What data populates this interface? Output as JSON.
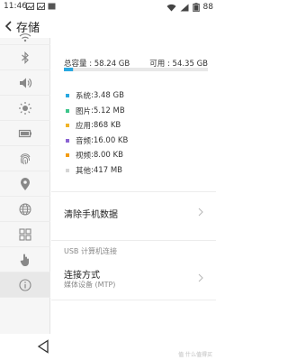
{
  "status": {
    "time": "11:46",
    "battery": "88"
  },
  "header": {
    "title": "存储"
  },
  "sidebar": {
    "items": [
      {
        "icon": "wifi-icon"
      },
      {
        "icon": "bluetooth-icon"
      },
      {
        "icon": "sound-icon"
      },
      {
        "icon": "brightness-icon"
      },
      {
        "icon": "battery-icon"
      },
      {
        "icon": "fingerprint-icon"
      },
      {
        "icon": "location-icon"
      },
      {
        "icon": "globe-icon"
      },
      {
        "icon": "apps-grid-icon"
      },
      {
        "icon": "hand-icon"
      },
      {
        "icon": "info-icon",
        "active": true
      }
    ]
  },
  "storage": {
    "total_label": "总容量 : 58.24 GB",
    "available_label": "可用 : 54.35 GB",
    "used_fraction": 0.067,
    "segments": [
      {
        "name": "系统",
        "value": "3.48 GB",
        "color": "#29a8e0",
        "fraction": 0.06
      },
      {
        "name": "图片",
        "value": "5.12 MB",
        "color": "#3cc58a",
        "fraction": 0.0015
      },
      {
        "name": "应用",
        "value": "868 KB",
        "color": "#f0b429",
        "fraction": 0.0015
      },
      {
        "name": "音频",
        "value": "16.00 KB",
        "color": "#8a63d2",
        "fraction": 0.001
      },
      {
        "name": "视频",
        "value": "8.00 KB",
        "color": "#f39c12",
        "fraction": 0.001
      },
      {
        "name": "其他",
        "value": "417 MB",
        "color": "#d5d5d5",
        "fraction": 0.007
      }
    ]
  },
  "actions": {
    "clear_data": "清除手机数据",
    "usb_section": "USB 计算机连接",
    "connection_mode": "连接方式",
    "connection_value": "媒体设备 (MTP)"
  },
  "watermark": "值 什么值得买"
}
